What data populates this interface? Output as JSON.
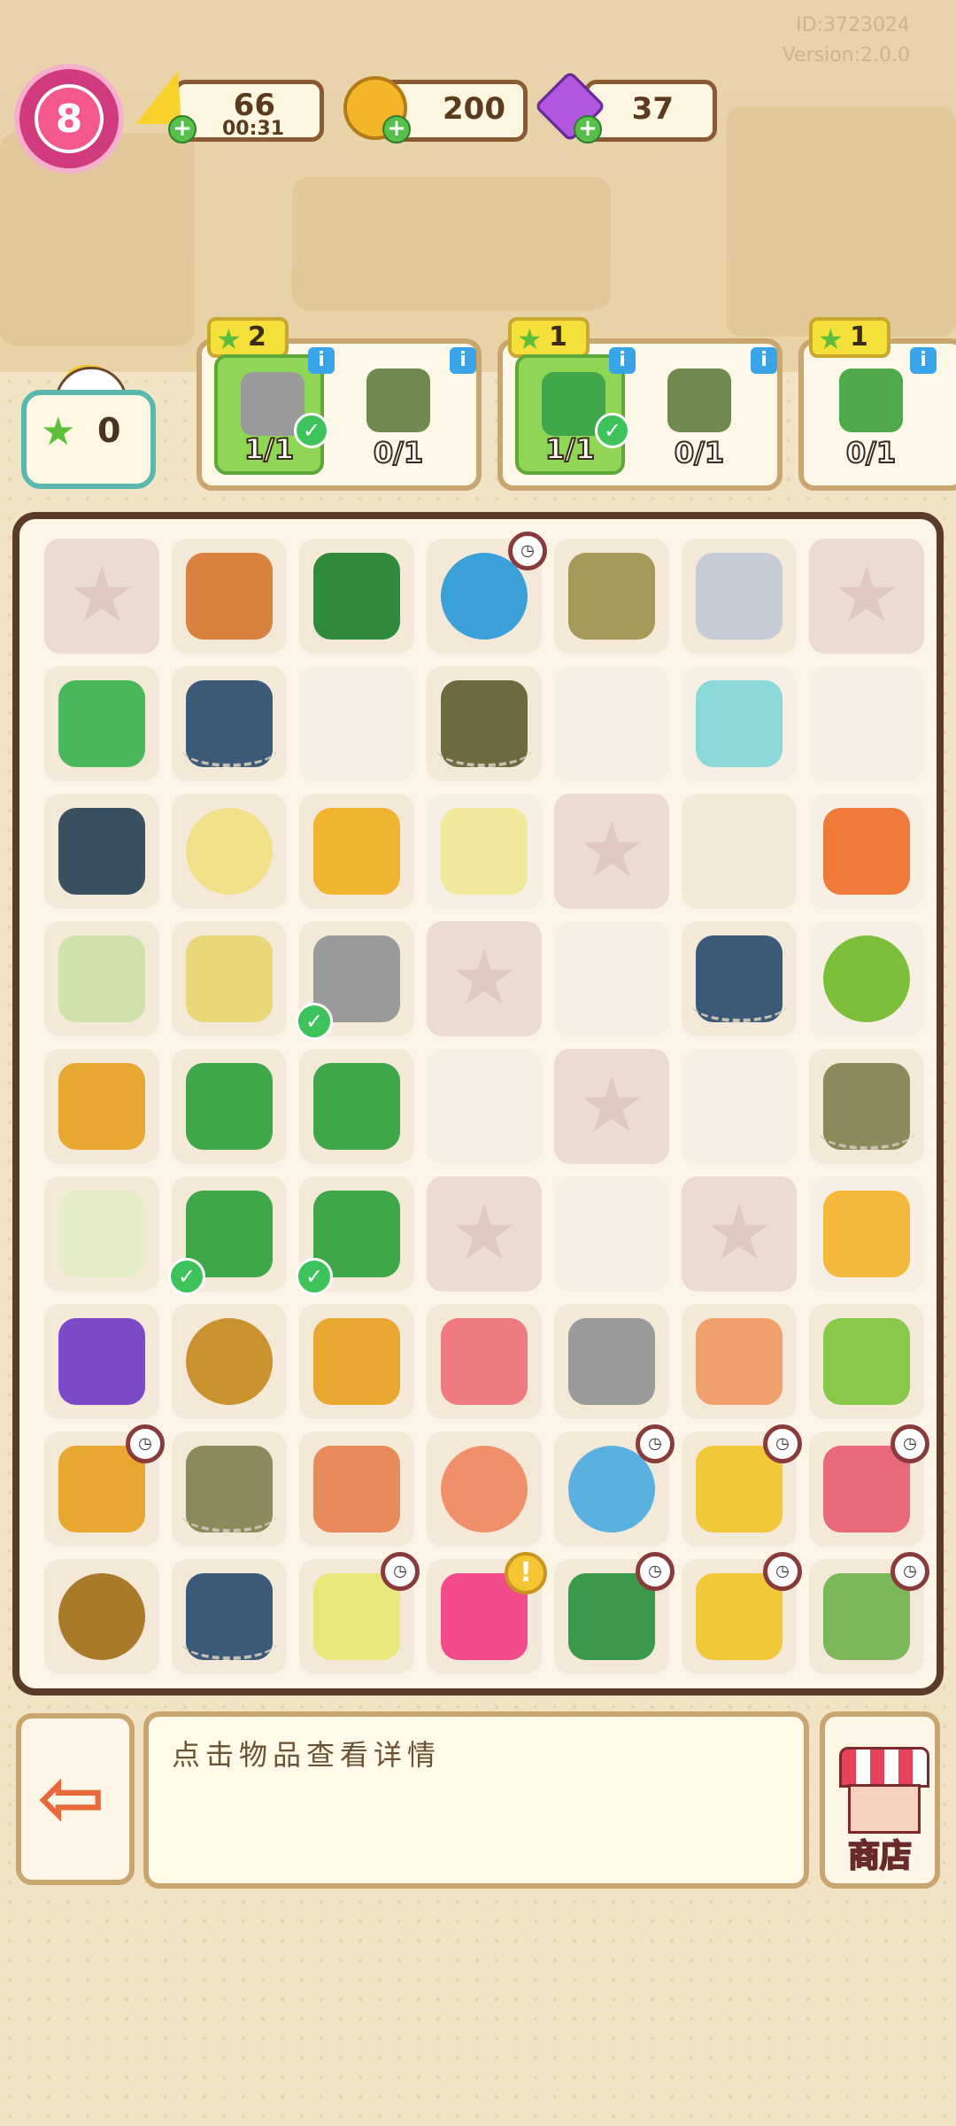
{
  "meta": {
    "id_text": "ID:3723024",
    "version_text": "Version:2.0.0"
  },
  "player": {
    "level": "8"
  },
  "resources": {
    "energy": {
      "value": "66",
      "timer": "00:31"
    },
    "coins": {
      "value": "200"
    },
    "gems": {
      "value": "37"
    }
  },
  "star_counter": {
    "value": "0"
  },
  "quests": [
    {
      "reward_stars": "2",
      "slots": [
        {
          "progress": "1/1",
          "done": true,
          "icon": "wrench-icon"
        },
        {
          "progress": "0/1",
          "done": false,
          "icon": "gloves-icon"
        }
      ]
    },
    {
      "reward_stars": "1",
      "slots": [
        {
          "progress": "1/1",
          "done": true,
          "icon": "pliers-icon"
        },
        {
          "progress": "0/1",
          "done": false,
          "icon": "gloves-icon"
        }
      ]
    },
    {
      "reward_stars": "1",
      "slots": [
        {
          "progress": "0/1",
          "done": false,
          "icon": "hose-icon"
        }
      ]
    }
  ],
  "description": {
    "placeholder": "点击物品查看详情"
  },
  "shop": {
    "label": "商店"
  },
  "colors": {
    "accent_level": "#d13a7c",
    "quest_done": "#8fd657",
    "board_border": "#5a3b2a"
  }
}
